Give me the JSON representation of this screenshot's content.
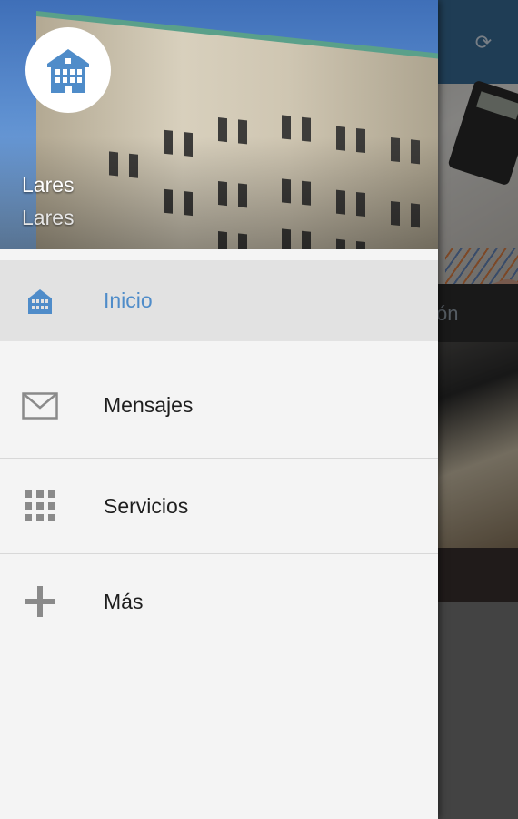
{
  "background_app": {
    "refresh_icon": "refresh-icon",
    "partial_label": "ón"
  },
  "drawer": {
    "header": {
      "logo_icon": "building-logo-icon",
      "account_name": "Lares",
      "account_subtitle": "Lares"
    },
    "items": [
      {
        "label": "Inicio",
        "icon": "building-icon",
        "active": true
      },
      {
        "label": "Mensajes",
        "icon": "mail-icon",
        "active": false
      },
      {
        "label": "Servicios",
        "icon": "grid-icon",
        "active": false
      },
      {
        "label": "Más",
        "icon": "plus-icon",
        "active": false
      }
    ]
  },
  "colors": {
    "accent": "#4f8cc9",
    "toolbar": "#3a6f9c",
    "icon_gray": "#8a8a8a"
  }
}
